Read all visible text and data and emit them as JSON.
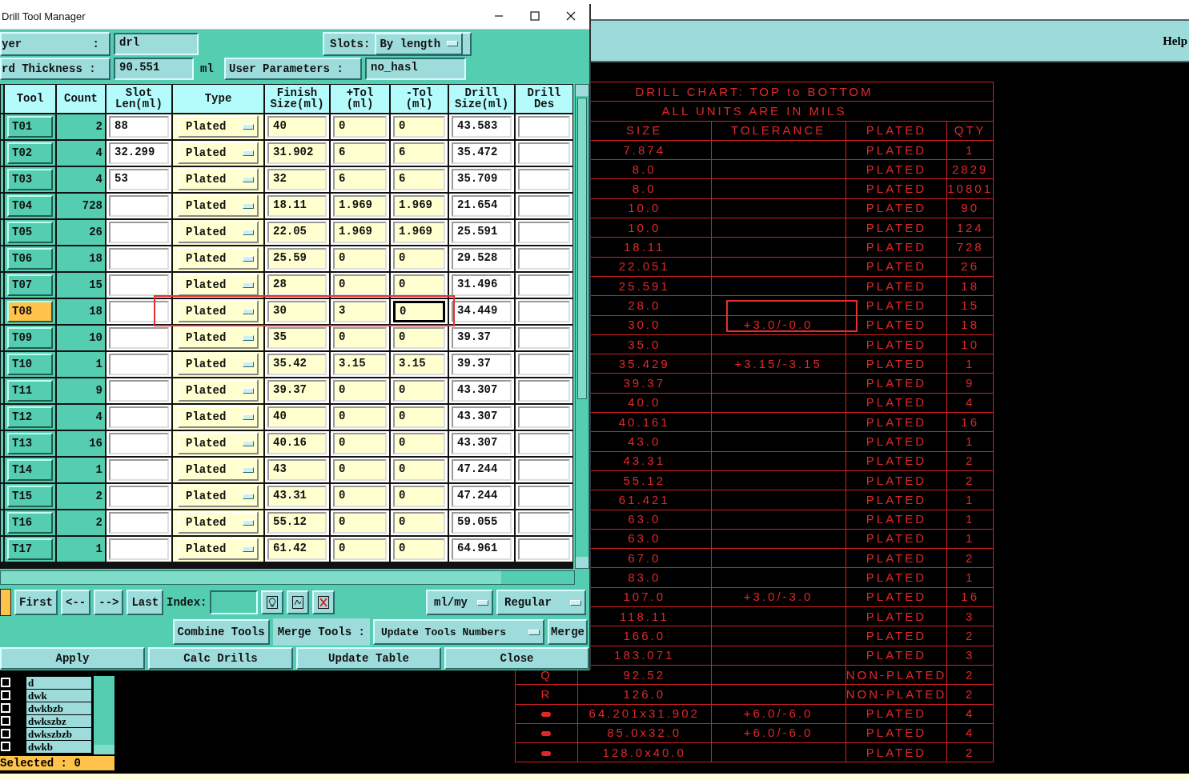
{
  "window": {
    "title": "Drill Tool Manager"
  },
  "menubar": {
    "items": [
      "Help"
    ]
  },
  "dialog": {
    "layer": {
      "label": "yer :",
      "value": "drl"
    },
    "slots": {
      "label": "Slots:",
      "value": "By length"
    },
    "board_thickness": {
      "label": "rd Thickness :",
      "value": "90.551",
      "unit": "ml"
    },
    "user_parameters": {
      "label": "User Parameters :",
      "value": "no_hasl"
    },
    "columns": [
      "Tool",
      "Count",
      "Slot\nLen(ml)",
      "Type",
      "Finish\nSize(ml)",
      "+Tol\n(ml)",
      "-Tol\n(ml)",
      "Drill\nSize(ml)",
      "Drill\nDes"
    ],
    "rows": [
      {
        "tool": "T01",
        "count": "2",
        "slot_len": "88",
        "type": "Plated",
        "finish": "40",
        "tol_plus": "0",
        "tol_minus": "0",
        "drill_size": "43.583",
        "selected": false,
        "focused": false
      },
      {
        "tool": "T02",
        "count": "4",
        "slot_len": "32.299",
        "type": "Plated",
        "finish": "31.902",
        "tol_plus": "6",
        "tol_minus": "6",
        "drill_size": "35.472",
        "selected": false,
        "focused": false
      },
      {
        "tool": "T03",
        "count": "4",
        "slot_len": "53",
        "type": "Plated",
        "finish": "32",
        "tol_plus": "6",
        "tol_minus": "6",
        "drill_size": "35.709",
        "selected": false,
        "focused": false
      },
      {
        "tool": "T04",
        "count": "728",
        "type": "Plated",
        "finish": "18.11",
        "tol_plus": "1.969",
        "tol_minus": "1.969",
        "drill_size": "21.654",
        "selected": false,
        "focused": false
      },
      {
        "tool": "T05",
        "count": "26",
        "type": "Plated",
        "finish": "22.05",
        "tol_plus": "1.969",
        "tol_minus": "1.969",
        "drill_size": "25.591",
        "selected": false,
        "focused": false
      },
      {
        "tool": "T06",
        "count": "18",
        "type": "Plated",
        "finish": "25.59",
        "tol_plus": "0",
        "tol_minus": "0",
        "drill_size": "29.528",
        "selected": false,
        "focused": false
      },
      {
        "tool": "T07",
        "count": "15",
        "type": "Plated",
        "finish": "28",
        "tol_plus": "0",
        "tol_minus": "0",
        "drill_size": "31.496",
        "selected": false,
        "focused": false
      },
      {
        "tool": "T08",
        "count": "18",
        "type": "Plated",
        "finish": "30",
        "tol_plus": "3",
        "tol_minus": "0",
        "drill_size": "34.449",
        "selected": true,
        "focused": true
      },
      {
        "tool": "T09",
        "count": "10",
        "type": "Plated",
        "finish": "35",
        "tol_plus": "0",
        "tol_minus": "0",
        "drill_size": "39.37",
        "selected": false,
        "focused": false
      },
      {
        "tool": "T10",
        "count": "1",
        "type": "Plated",
        "finish": "35.42",
        "tol_plus": "3.15",
        "tol_minus": "3.15",
        "drill_size": "39.37",
        "selected": false,
        "focused": false
      },
      {
        "tool": "T11",
        "count": "9",
        "type": "Plated",
        "finish": "39.37",
        "tol_plus": "0",
        "tol_minus": "0",
        "drill_size": "43.307",
        "selected": false,
        "focused": false
      },
      {
        "tool": "T12",
        "count": "4",
        "type": "Plated",
        "finish": "40",
        "tol_plus": "0",
        "tol_minus": "0",
        "drill_size": "43.307",
        "selected": false,
        "focused": false
      },
      {
        "tool": "T13",
        "count": "16",
        "type": "Plated",
        "finish": "40.16",
        "tol_plus": "0",
        "tol_minus": "0",
        "drill_size": "43.307",
        "selected": false,
        "focused": false
      },
      {
        "tool": "T14",
        "count": "1",
        "type": "Plated",
        "finish": "43",
        "tol_plus": "0",
        "tol_minus": "0",
        "drill_size": "47.244",
        "selected": false,
        "focused": false
      },
      {
        "tool": "T15",
        "count": "2",
        "type": "Plated",
        "finish": "43.31",
        "tol_plus": "0",
        "tol_minus": "0",
        "drill_size": "47.244",
        "selected": false,
        "focused": false
      },
      {
        "tool": "T16",
        "count": "2",
        "type": "Plated",
        "finish": "55.12",
        "tol_plus": "0",
        "tol_minus": "0",
        "drill_size": "59.055",
        "selected": false,
        "focused": false
      },
      {
        "tool": "T17",
        "count": "1",
        "type": "Plated",
        "finish": "61.42",
        "tol_plus": "0",
        "tol_minus": "0",
        "drill_size": "64.961",
        "selected": false,
        "focused": false
      }
    ],
    "nav_buttons": [
      "First",
      "<--",
      "-->",
      "Last"
    ],
    "index": {
      "label": "Index:"
    },
    "units": "ml/my",
    "mode": "Regular",
    "combine": "Combine Tools",
    "merge_label": "Merge Tools :",
    "merge_mode": "Update Tools Numbers",
    "merge": "Merge",
    "actions": [
      "Apply",
      "Calc Drills",
      "Update Table",
      "Close"
    ]
  },
  "layer_list": {
    "items": [
      {
        "label": "d",
        "checked": false
      },
      {
        "label": "dwk",
        "checked": false
      },
      {
        "label": "dwkbzb",
        "checked": false
      },
      {
        "label": "dwkszbz",
        "checked": false
      },
      {
        "label": "dwkszbzb",
        "checked": false
      },
      {
        "label": "dwkb",
        "checked": false
      }
    ],
    "selected_count": "Selected : 0"
  },
  "chart": {
    "title": "DRILL CHART: TOP to BOTTOM",
    "subtitle": "ALL UNITS ARE IN MILS",
    "columns": [
      "SIZE",
      "TOLERANCE",
      "PLATED",
      "QTY"
    ],
    "rows": [
      {
        "size": "7.874",
        "plated": "PLATED",
        "qty": "1"
      },
      {
        "size": "8.0",
        "plated": "PLATED",
        "qty": "2829"
      },
      {
        "size": "8.0",
        "plated": "PLATED",
        "qty": "10801"
      },
      {
        "size": "10.0",
        "plated": "PLATED",
        "qty": "90"
      },
      {
        "size": "10.0",
        "plated": "PLATED",
        "qty": "124"
      },
      {
        "size": "18.11",
        "plated": "PLATED",
        "qty": "728"
      },
      {
        "size": "22.051",
        "plated": "PLATED",
        "qty": "26"
      },
      {
        "size": "25.591",
        "plated": "PLATED",
        "qty": "18"
      },
      {
        "size": "28.0",
        "plated": "PLATED",
        "qty": "15"
      },
      {
        "size": "30.0",
        "tolerance": "+3.0/-0.0",
        "plated": "PLATED",
        "qty": "18"
      },
      {
        "size": "35.0",
        "plated": "PLATED",
        "qty": "10"
      },
      {
        "size": "35.429",
        "tolerance": "+3.15/-3.15",
        "plated": "PLATED",
        "qty": "1"
      },
      {
        "size": "39.37",
        "plated": "PLATED",
        "qty": "9"
      },
      {
        "size": "40.0",
        "plated": "PLATED",
        "qty": "4"
      },
      {
        "size": "40.161",
        "plated": "PLATED",
        "qty": "16"
      },
      {
        "size": "43.0",
        "plated": "PLATED",
        "qty": "1"
      },
      {
        "size": "43.31",
        "plated": "PLATED",
        "qty": "2"
      },
      {
        "size": "55.12",
        "plated": "PLATED",
        "qty": "2"
      },
      {
        "size": "61.421",
        "plated": "PLATED",
        "qty": "1"
      },
      {
        "size": "63.0",
        "plated": "PLATED",
        "qty": "1"
      },
      {
        "size": "63.0",
        "plated": "PLATED",
        "qty": "1"
      },
      {
        "size": "67.0",
        "plated": "PLATED",
        "qty": "2"
      },
      {
        "size": "83.0",
        "plated": "PLATED",
        "qty": "1"
      },
      {
        "size": "107.0",
        "tolerance": "+3.0/-3.0",
        "plated": "PLATED",
        "qty": "16"
      },
      {
        "size": "118.11",
        "plated": "PLATED",
        "qty": "3"
      },
      {
        "size": "166.0",
        "plated": "PLATED",
        "qty": "2"
      },
      {
        "size": "183.071",
        "plated": "PLATED",
        "qty": "3"
      },
      {
        "symbol": {
          "kind": "letter",
          "text": "Q"
        },
        "size": "92.52",
        "plated": "NON-PLATED",
        "qty": "2"
      },
      {
        "symbol": {
          "kind": "letter",
          "text": "R"
        },
        "size": "126.0",
        "plated": "NON-PLATED",
        "qty": "2"
      },
      {
        "symbol": {
          "kind": "slot"
        },
        "size": "64.201x31.902",
        "tolerance": "+6.0/-6.0",
        "plated": "PLATED",
        "qty": "4"
      },
      {
        "symbol": {
          "kind": "slot"
        },
        "size": "85.0x32.0",
        "tolerance": "+6.0/-6.0",
        "plated": "PLATED",
        "qty": "4"
      },
      {
        "symbol": {
          "kind": "slot"
        },
        "size": "128.0x40.0",
        "plated": "PLATED",
        "qty": "2"
      }
    ]
  }
}
